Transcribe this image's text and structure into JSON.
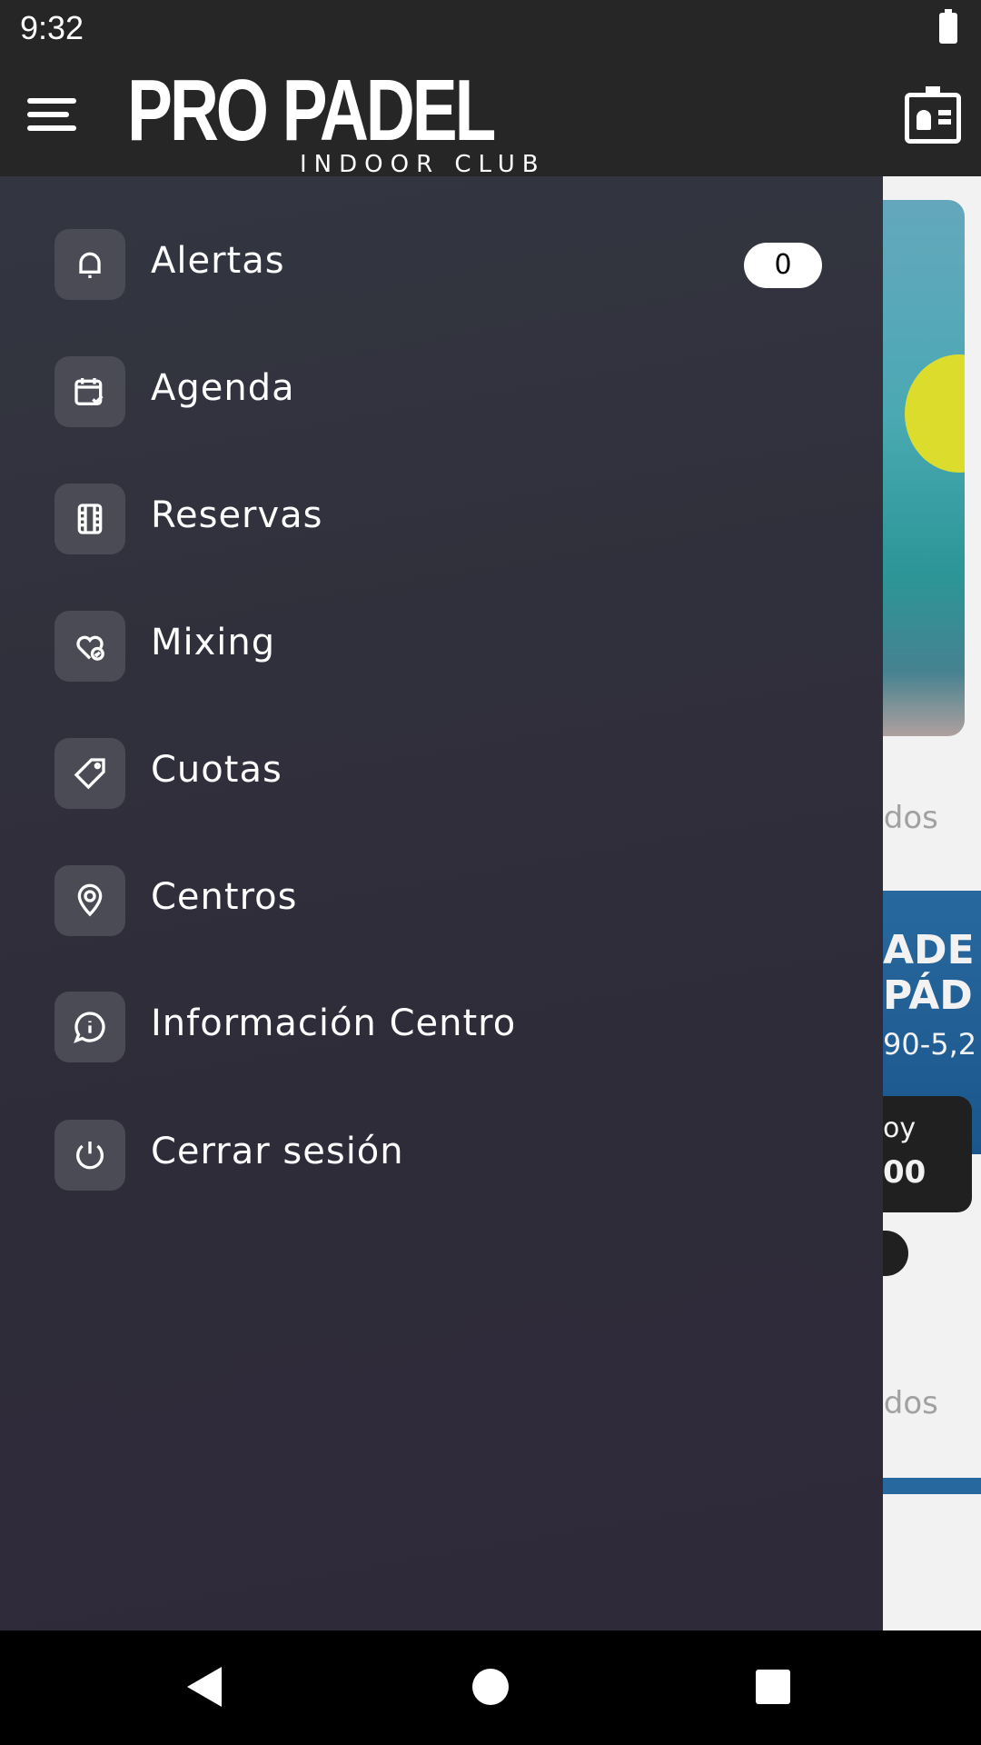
{
  "status_bar": {
    "time": "9:32",
    "battery_icon": "battery-full-icon"
  },
  "header": {
    "logo_main": "PRO PADEL",
    "logo_sub": "INDOOR CLUB",
    "menu_icon": "hamburger-icon",
    "profile_icon": "id-card-icon"
  },
  "drawer": {
    "items": [
      {
        "label": "Alertas",
        "icon": "bell-icon",
        "badge": "0"
      },
      {
        "label": "Agenda",
        "icon": "calendar-check-icon"
      },
      {
        "label": "Reservas",
        "icon": "film-grid-icon"
      },
      {
        "label": "Mixing",
        "icon": "heart-check-icon"
      },
      {
        "label": "Cuotas",
        "icon": "price-tag-icon"
      },
      {
        "label": "Centros",
        "icon": "map-pin-icon"
      },
      {
        "label": "Información Centro",
        "icon": "info-chat-icon"
      },
      {
        "label": "Cerrar sesión",
        "icon": "power-icon"
      }
    ]
  },
  "background": {
    "see_all_1": "odos",
    "banner_line1": "ADE",
    "banner_line2": "PÁD",
    "banner_line3": "90-5,2",
    "price_label": "oy",
    "price_value": "00",
    "see_all_2": "odos"
  },
  "nav": {
    "back": "back-icon",
    "home": "home-icon",
    "recents": "recents-icon"
  }
}
